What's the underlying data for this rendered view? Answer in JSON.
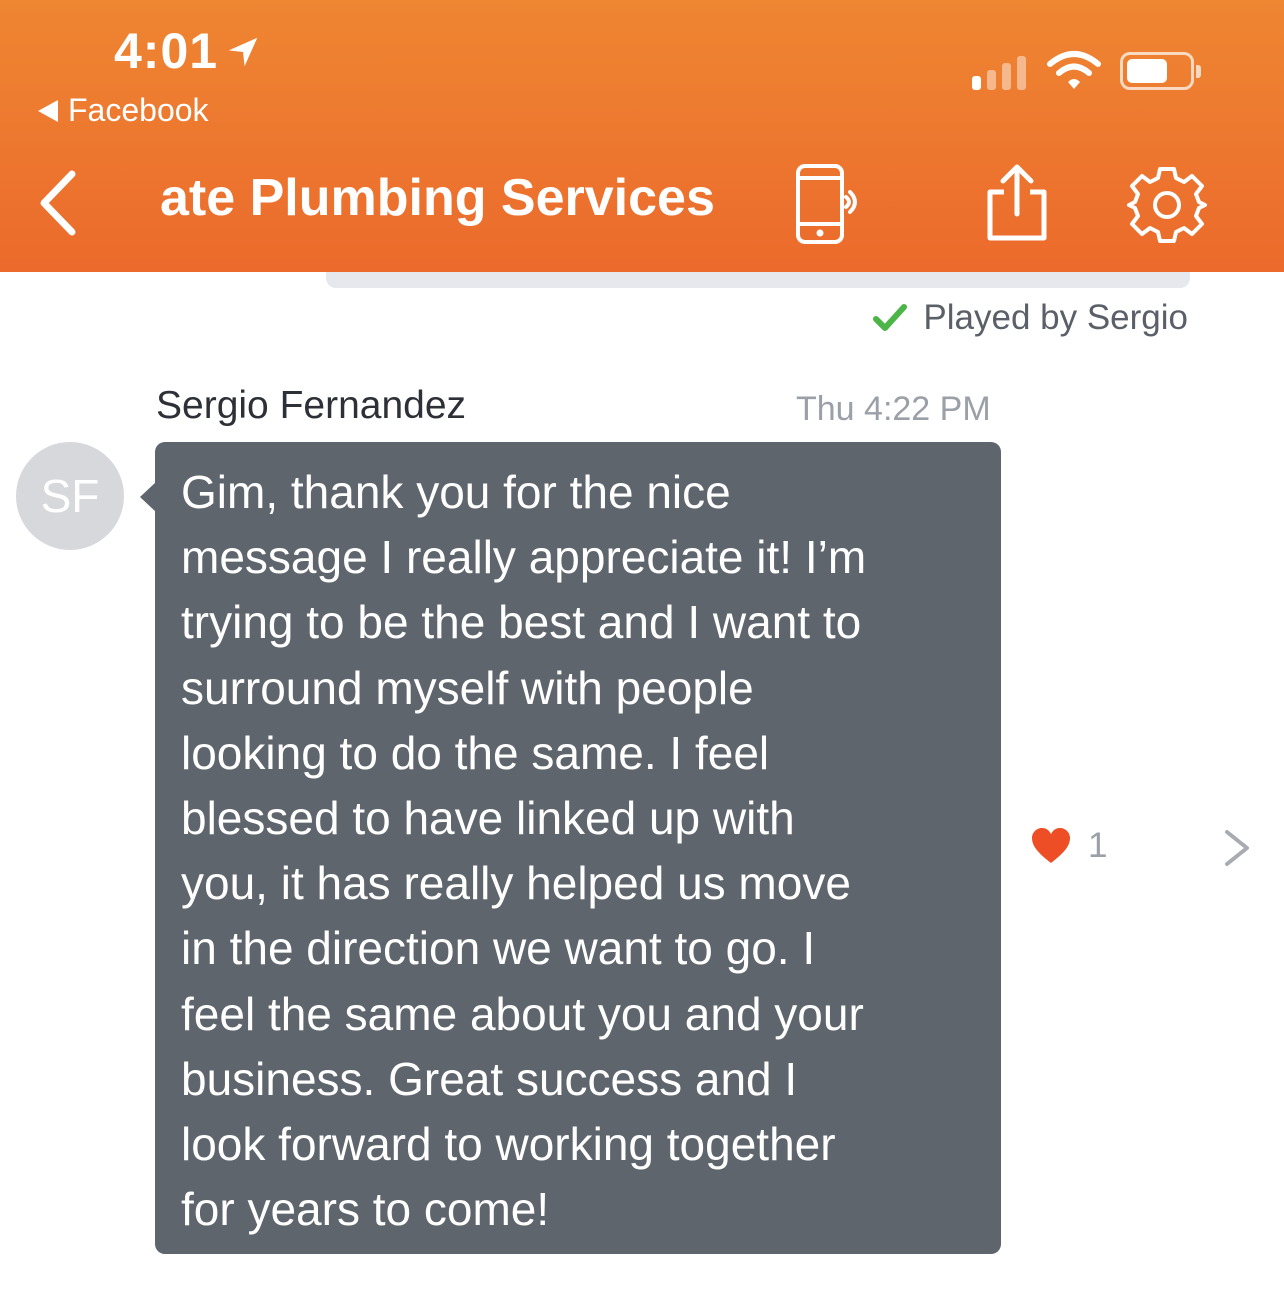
{
  "status_bar": {
    "time": "4:01",
    "back_app": "Facebook"
  },
  "nav": {
    "title": "ate Plumbing Services"
  },
  "message": {
    "played_status": "Played by Sergio",
    "sender": "Sergio Fernandez",
    "timestamp": "Thu 4:22 PM",
    "avatar_initials": "SF",
    "lines": [
      "Gim, thank you for the nice",
      "message I really appreciate it! I’m",
      "trying to be the best and I want to",
      "surround myself with people",
      "looking to do the same. I feel",
      "blessed to have linked up with",
      "you, it has really helped us move",
      "in the direction we want to go. I",
      "feel the same about you and your",
      "business. Great success and I",
      "look forward to working together",
      "for years to come!"
    ],
    "reaction_count": "1"
  },
  "colors": {
    "header": "#ec6a2c",
    "bubble": "#5f656c",
    "check": "#4cb548",
    "heart": "#ee4e26"
  },
  "icons": {
    "location": "location-arrow-icon",
    "back": "chevron-left-icon",
    "phone": "phone-speaker-icon",
    "share": "share-icon",
    "settings": "gear-icon",
    "check": "check-icon",
    "reaction": "heart-icon",
    "detail": "chevron-right-icon"
  }
}
